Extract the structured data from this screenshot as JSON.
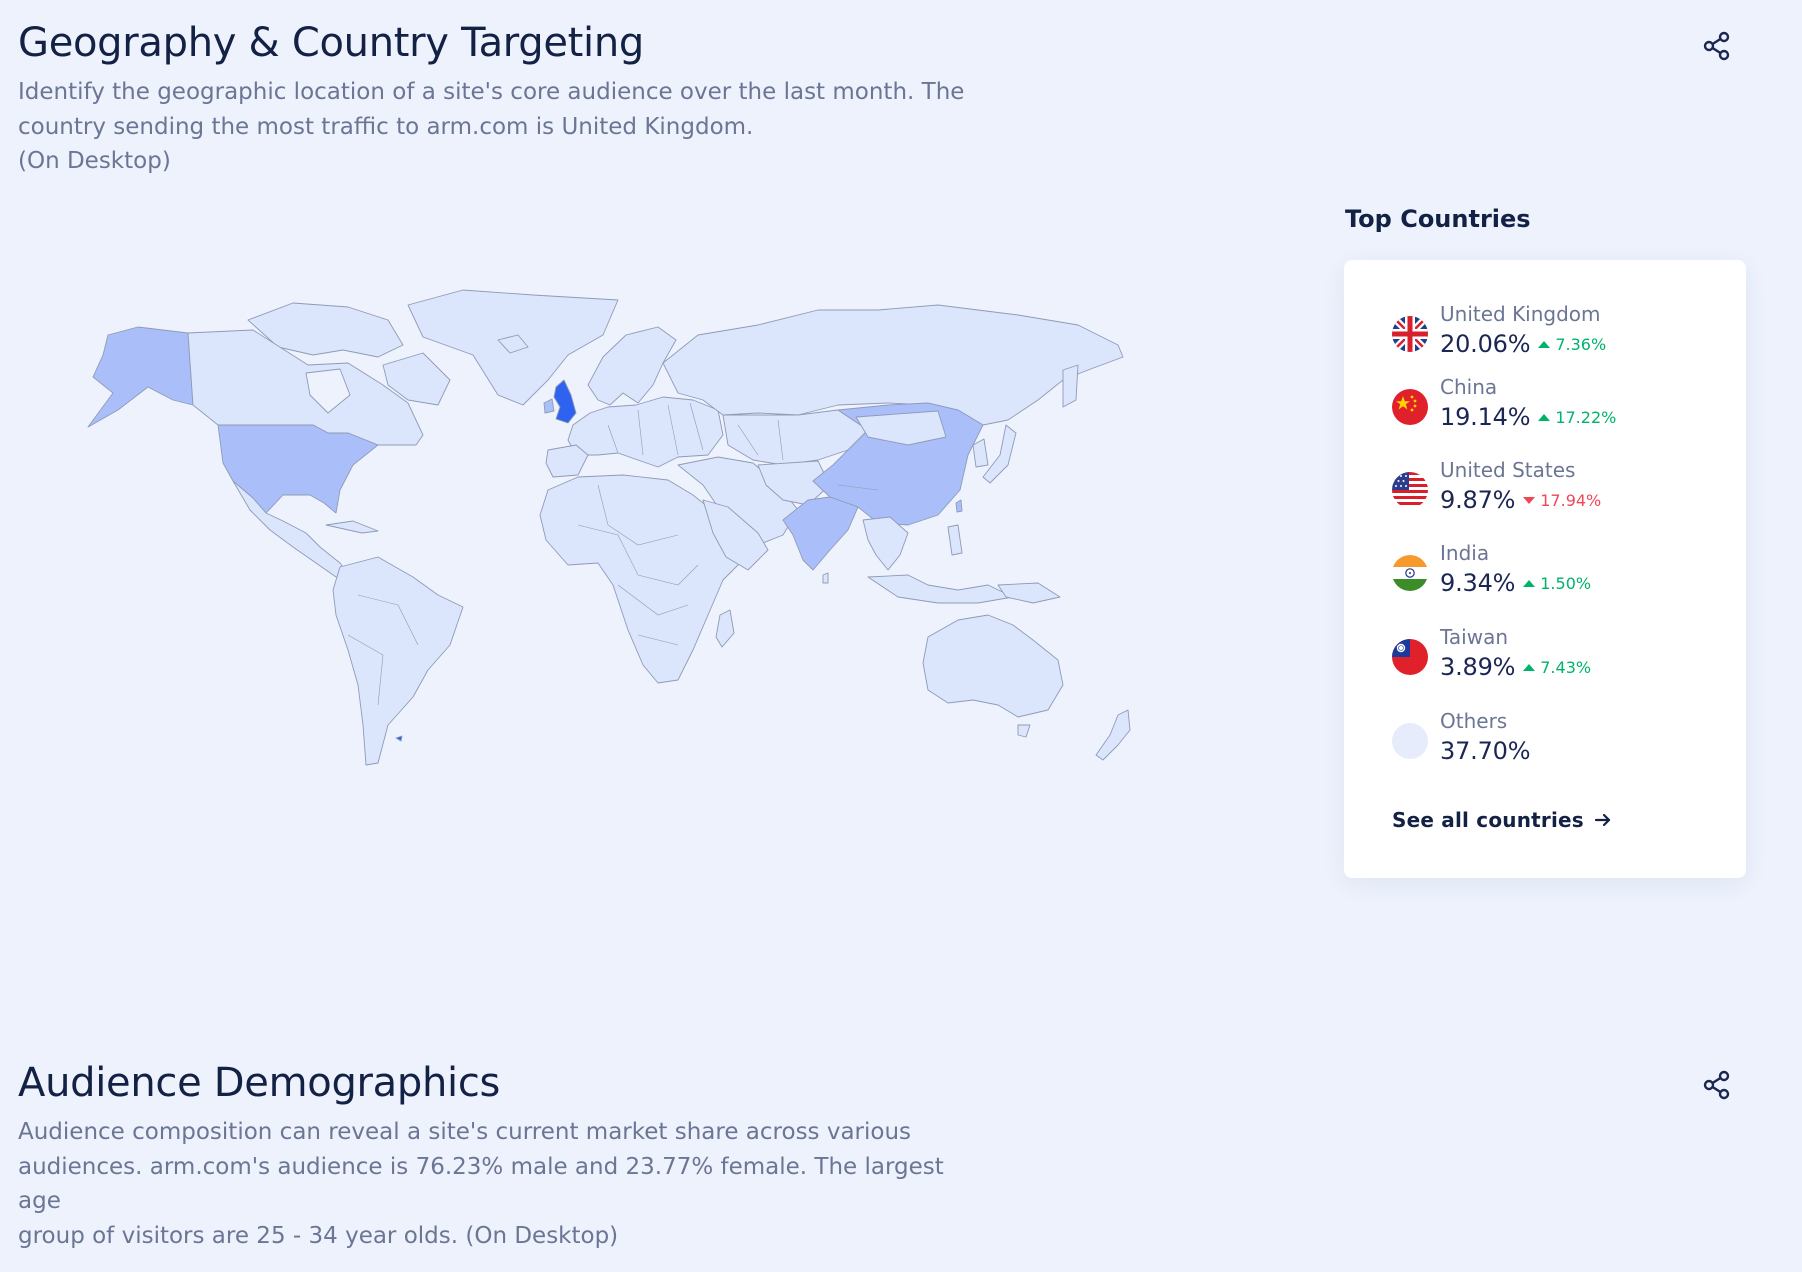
{
  "geography": {
    "title": "Geography & Country Targeting",
    "description_line1": "Identify the geographic location of a site's core audience over the last month. The",
    "description_line2": "country sending the most traffic to arm.com is United Kingdom.",
    "description_line3": "(On Desktop)"
  },
  "top_countries": {
    "title": "Top Countries",
    "items": [
      {
        "name": "United Kingdom",
        "share": "20.06%",
        "change": "7.36%",
        "direction": "up",
        "flag_icon": "uk-flag-icon"
      },
      {
        "name": "China",
        "share": "19.14%",
        "change": "17.22%",
        "direction": "up",
        "flag_icon": "china-flag-icon"
      },
      {
        "name": "United States",
        "share": "9.87%",
        "change": "17.94%",
        "direction": "down",
        "flag_icon": "usa-flag-icon"
      },
      {
        "name": "India",
        "share": "9.34%",
        "change": "1.50%",
        "direction": "up",
        "flag_icon": "india-flag-icon"
      },
      {
        "name": "Taiwan",
        "share": "3.89%",
        "change": "7.43%",
        "direction": "up",
        "flag_icon": "taiwan-flag-icon"
      }
    ],
    "others": {
      "name": "Others",
      "share": "37.70%"
    },
    "see_all_label": "See all countries"
  },
  "demographics": {
    "title": "Audience Demographics",
    "description_line1": "Audience composition can reveal a site's current market share across various",
    "description_line2": "audiences. arm.com's audience is 76.23% male and 23.77% female. The largest age",
    "description_line3": "group of visitors are 25 - 34 year olds. (On Desktop)"
  },
  "colors": {
    "background": "#edf2fc",
    "land_default": "#dbe5fb",
    "land_medium": "#aabff9",
    "land_top": "#2f62ef",
    "positive": "#00b36b",
    "negative": "#ef4757"
  },
  "icons": {
    "share": "share-icon",
    "arrow_right": "arrow-right-icon"
  }
}
